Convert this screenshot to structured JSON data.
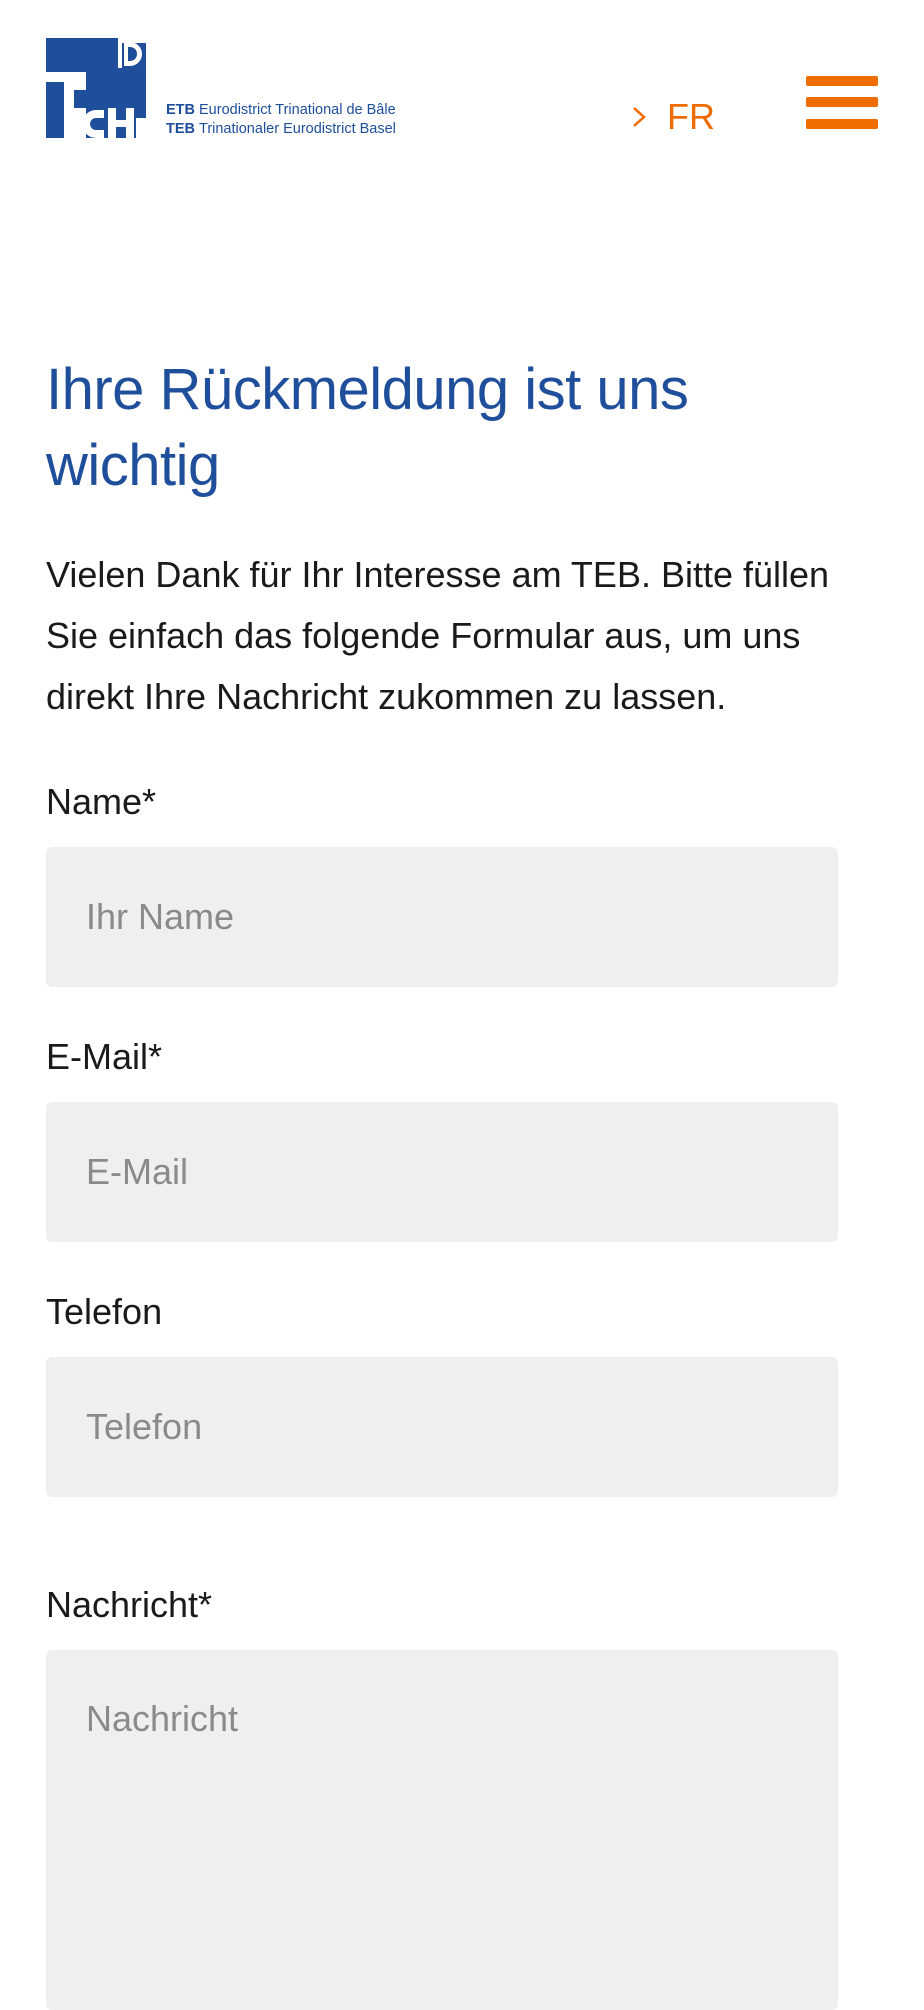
{
  "header": {
    "logo": {
      "line1_abbr": "ETB",
      "line1_text": "Eurodistrict Trinational de Bâle",
      "line2_abbr": "TEB",
      "line2_text": "Trinationaler Eurodistrict Basel",
      "mark_letters": "F D CH",
      "brand_color": "#1f4e9b"
    },
    "language_link": "FR",
    "menu_icon": "hamburger-icon",
    "accent_color": "#ef6c00"
  },
  "main": {
    "title": "Ihre Rückmeldung ist uns wichtig",
    "intro": "Vielen Dank für Ihr Interesse am TEB. Bitte füllen Sie einfach das folgende Formular aus, um uns direkt Ihre Nachricht zukommen zu lassen."
  },
  "form": {
    "name": {
      "label": "Name*",
      "placeholder": "Ihr Name",
      "value": ""
    },
    "email": {
      "label": "E-Mail*",
      "placeholder": "E-Mail",
      "value": ""
    },
    "phone": {
      "label": "Telefon",
      "placeholder": "Telefon",
      "value": ""
    },
    "message": {
      "label": "Nachricht*",
      "placeholder": "Nachricht",
      "value": ""
    }
  }
}
